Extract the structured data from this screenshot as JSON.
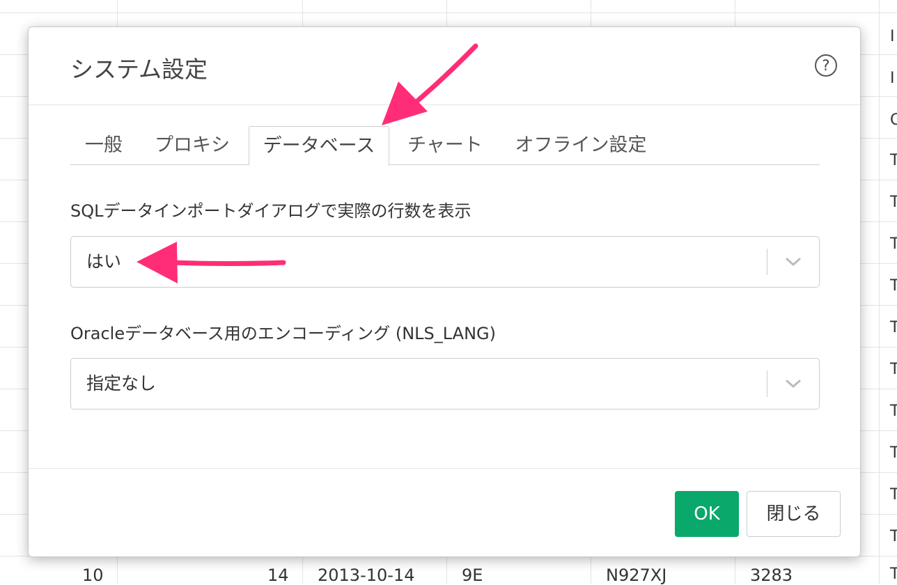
{
  "background": {
    "right_edge_chars": [
      "I",
      "I",
      "C",
      "T",
      "T",
      "T",
      "T",
      "T",
      "T",
      "T",
      "T",
      "T",
      "T",
      "T"
    ],
    "bottom_row": [
      "10",
      "14",
      "2013-10-14",
      "9E",
      "N927XJ",
      "3283"
    ]
  },
  "dialog": {
    "title": "システム設定",
    "help_icon": "question-circle-icon",
    "tabs": [
      {
        "label": "一般",
        "active": false
      },
      {
        "label": "プロキシ",
        "active": false
      },
      {
        "label": "データベース",
        "active": true
      },
      {
        "label": "チャート",
        "active": false
      },
      {
        "label": "オフライン設定",
        "active": false
      }
    ],
    "fields": [
      {
        "label": "SQLデータインポートダイアログで実際の行数を表示",
        "value": "はい"
      },
      {
        "label": "Oracleデータベース用のエンコーディング (NLS_LANG)",
        "value": "指定なし"
      }
    ],
    "buttons": {
      "ok": "OK",
      "close": "閉じる"
    }
  },
  "colors": {
    "accent_green": "#0aa86b",
    "annotation_pink": "#ff2d78"
  }
}
